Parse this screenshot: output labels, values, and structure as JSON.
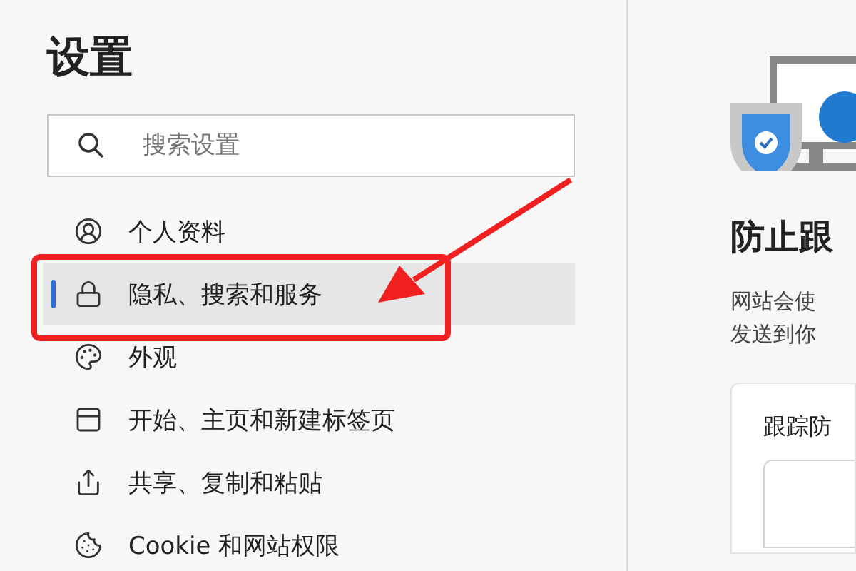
{
  "sidebar": {
    "title": "设置",
    "search": {
      "placeholder": "搜索设置"
    },
    "items": [
      {
        "label": "个人资料",
        "selected": false
      },
      {
        "label": "隐私、搜索和服务",
        "selected": true
      },
      {
        "label": "外观",
        "selected": false
      },
      {
        "label": "开始、主页和新建标签页",
        "selected": false
      },
      {
        "label": "共享、复制和粘贴",
        "selected": false
      },
      {
        "label": "Cookie 和网站权限",
        "selected": false
      }
    ]
  },
  "content": {
    "heading": "防止跟",
    "description": [
      "网站会使",
      "发送到你"
    ],
    "card": {
      "title": "跟踪防"
    }
  }
}
